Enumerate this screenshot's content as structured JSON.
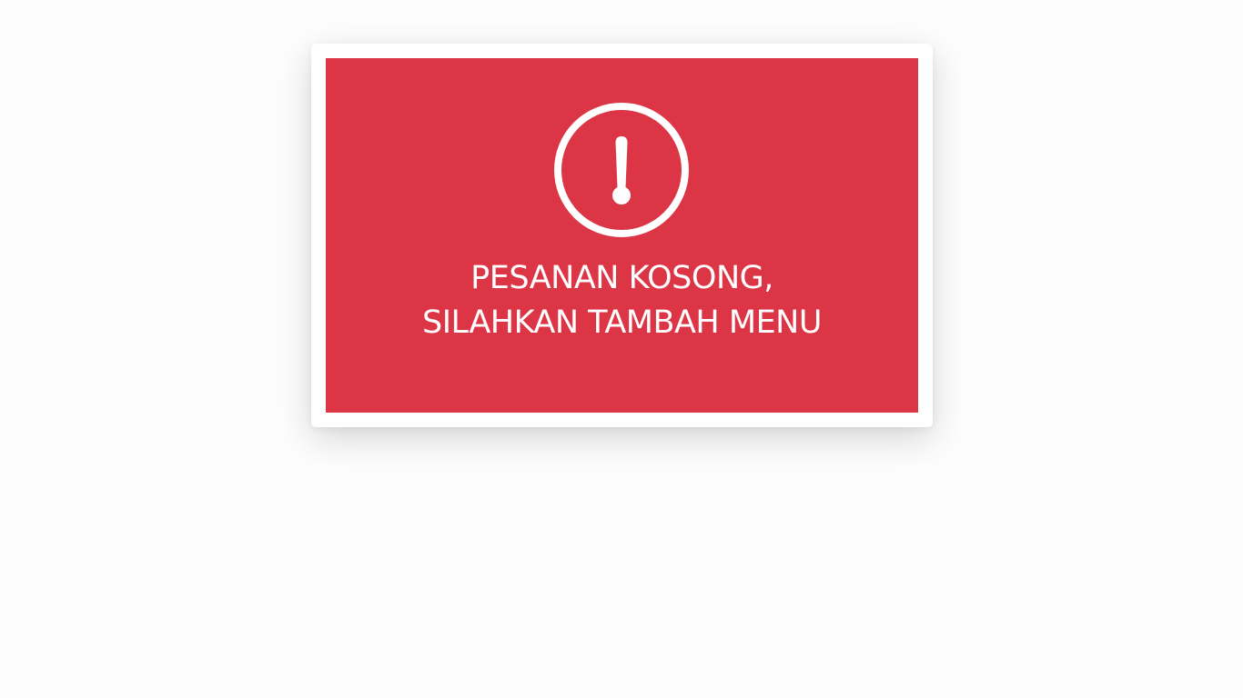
{
  "alert": {
    "icon": "exclamation-circle-icon",
    "line1": "PESANAN KOSONG,",
    "line2": "SILAHKAN TAMBAH MENU"
  },
  "colors": {
    "background": "#fdfdfd",
    "card": "#ffffff",
    "alert": "#dc3545",
    "text": "#ffffff"
  }
}
